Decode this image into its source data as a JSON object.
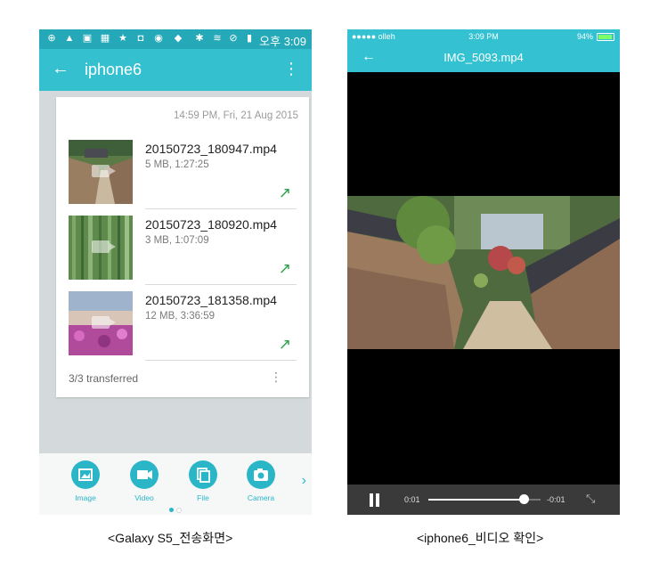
{
  "android": {
    "status": {
      "time": "오후 3:09",
      "icons": [
        "add-icon",
        "warning-icon",
        "chart-icon",
        "image-icon",
        "star-icon",
        "app-icon",
        "record-icon",
        "app-icon",
        "bluetooth-icon",
        "wifi-icon",
        "block-icon",
        "battery-icon"
      ]
    },
    "appbar": {
      "title": "iphone6",
      "back_icon": "←",
      "more_icon": "⋮"
    },
    "card": {
      "date": "14:59 PM, Fri, 21 Aug 2015",
      "files": [
        {
          "name": "20150723_180947.mp4",
          "meta": "5 MB, 1:27:25"
        },
        {
          "name": "20150723_180920.mp4",
          "meta": "3 MB, 1:07:09"
        },
        {
          "name": "20150723_181358.mp4",
          "meta": "12 MB, 3:36:59"
        }
      ],
      "arrow_icon": "↗",
      "transferred": "3/3 transferred",
      "more_icon": "⋮"
    },
    "bottom": {
      "buttons": [
        {
          "label": "Image",
          "icon": "image-icon"
        },
        {
          "label": "Video",
          "icon": "video-icon"
        },
        {
          "label": "File",
          "icon": "file-icon"
        },
        {
          "label": "Camera",
          "icon": "camera-icon"
        }
      ],
      "next_icon": "›",
      "active_page": 1,
      "page_count": 2
    },
    "accent": "#35c0cf"
  },
  "iphone": {
    "status": {
      "carrier": "●●●●● olleh",
      "time": "3:09 PM",
      "battery": "94%"
    },
    "nav": {
      "title": "IMG_5093.mp4",
      "back_icon": "←"
    },
    "player": {
      "current": "0:01",
      "remaining": "-0:01",
      "progress": 0.85,
      "expand_icon": "⤡"
    }
  },
  "captions": {
    "left": "<Galaxy S5_전송화면>",
    "right": "<iphone6_비디오 확인>"
  }
}
